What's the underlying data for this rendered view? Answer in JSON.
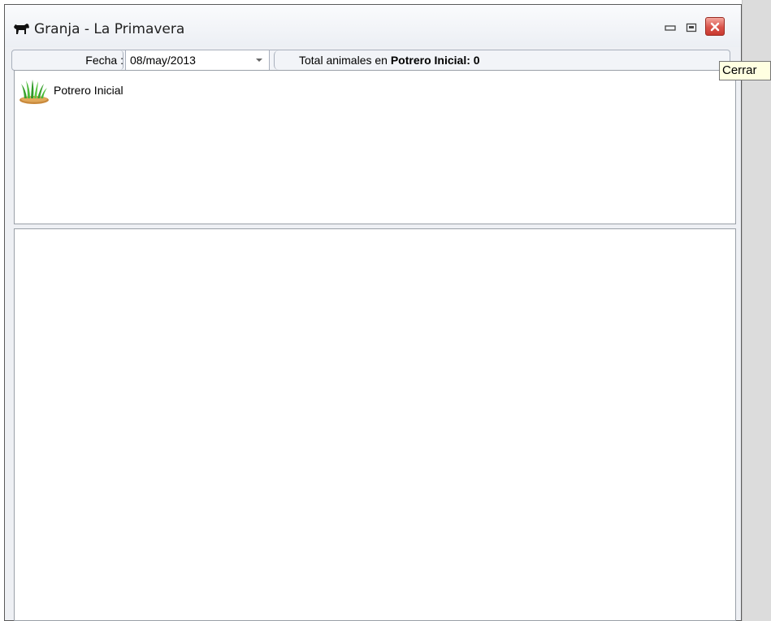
{
  "window": {
    "title": "Granja - La Primavera"
  },
  "toolbar": {
    "fecha_label": "Fecha :",
    "date_value": "08/may/2013",
    "total_prefix": "Total animales en ",
    "total_bold": "Potrero Inicial: 0"
  },
  "tree": {
    "items": [
      {
        "label": "Potrero Inicial",
        "icon": "grass-icon"
      }
    ]
  },
  "tooltip": {
    "text": "Cerrar"
  },
  "colors": {
    "close_button": "#d9534a",
    "tooltip_bg": "#ffffe1",
    "panel_border": "#9aa0a8"
  }
}
